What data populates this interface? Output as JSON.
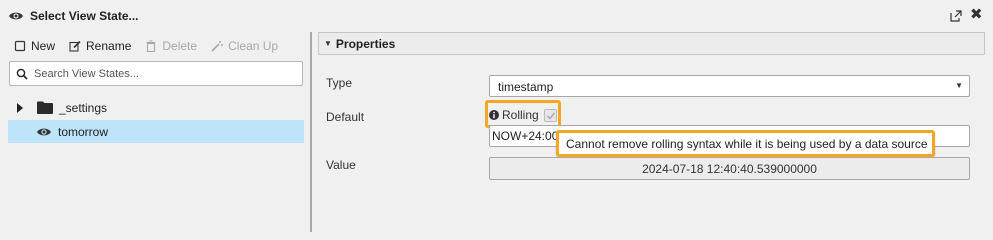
{
  "window": {
    "title": "Select View State...",
    "title_icon": "eye-icon",
    "popout_icon": "popout-icon",
    "close_icon": "close-icon"
  },
  "toolbar": {
    "new_label": "New",
    "rename_label": "Rename",
    "delete_label": "Delete",
    "cleanup_label": "Clean Up"
  },
  "search": {
    "placeholder": "Search View States..."
  },
  "tree": {
    "items": [
      {
        "label": "_settings",
        "icon": "folder-icon",
        "expanded": false
      },
      {
        "label": "tomorrow",
        "icon": "eye-icon",
        "selected": true
      }
    ]
  },
  "properties": {
    "header": "Properties",
    "type_label": "Type",
    "type_value": "timestamp",
    "default_label": "Default",
    "rolling_label": "Rolling",
    "rolling_checked": true,
    "default_value": "NOW+24:00",
    "tooltip": "Cannot remove rolling syntax while it is being used by a data source",
    "value_label": "Value",
    "value": "2024-07-18 12:40:40.539000000"
  },
  "colors": {
    "accent_highlight": "#f5a623",
    "selected_row": "#bde4f8",
    "disabled_text": "#a8a8a8"
  }
}
